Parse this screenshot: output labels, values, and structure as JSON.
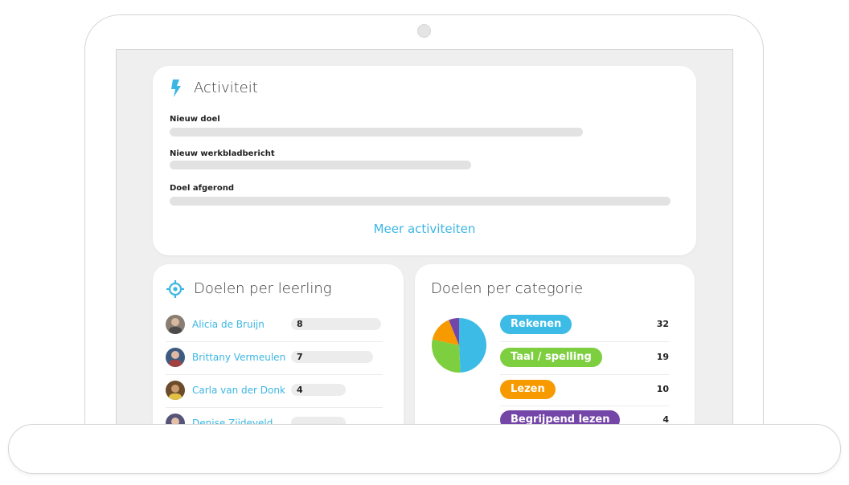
{
  "activity": {
    "title": "Activiteit",
    "items": [
      {
        "label": "Nieuw doel"
      },
      {
        "label": "Nieuw werkbladbericht"
      },
      {
        "label": "Doel afgerond"
      }
    ],
    "more_link": "Meer activiteiten"
  },
  "students": {
    "title": "Doelen per leerling",
    "rows": [
      {
        "name": "Alicia de Bruijn",
        "count": "8"
      },
      {
        "name": "Brittany Vermeulen",
        "count": "7"
      },
      {
        "name": "Carla van der Donk",
        "count": "4"
      },
      {
        "name": "Denise Zijdeveld",
        "count": ""
      }
    ]
  },
  "categories": {
    "title": "Doelen per categorie",
    "rows": [
      {
        "label": "Rekenen",
        "count": "32",
        "color": "#3bbbe6"
      },
      {
        "label": "Taal / spelling",
        "count": "19",
        "color": "#7dcf40"
      },
      {
        "label": "Lezen",
        "count": "10",
        "color": "#f79a00"
      },
      {
        "label": "Begrijpend lezen",
        "count": "4",
        "color": "#7446a8"
      }
    ]
  },
  "chart_data": {
    "type": "pie",
    "categories": [
      "Rekenen",
      "Taal / spelling",
      "Lezen",
      "Begrijpend lezen"
    ],
    "values": [
      32,
      19,
      10,
      4
    ],
    "colors": [
      "#3bbbe6",
      "#7dcf40",
      "#f79a00",
      "#7446a8"
    ]
  }
}
